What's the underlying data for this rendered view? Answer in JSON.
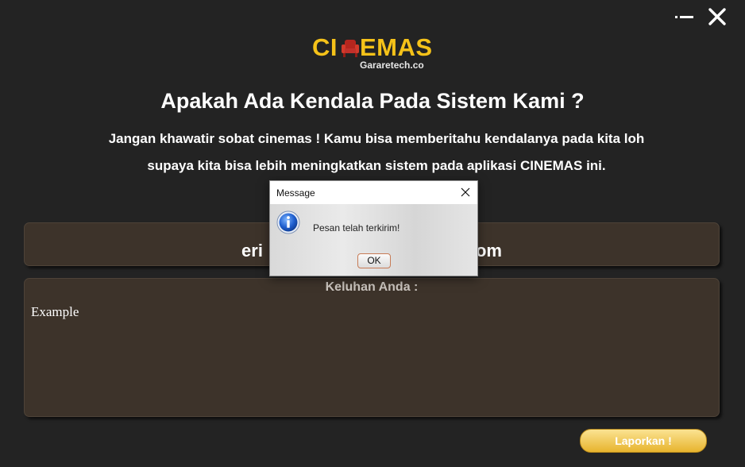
{
  "window_controls": {
    "minimize_icon": "minimize-icon",
    "close_icon": "close-icon"
  },
  "logo": {
    "text_left": "CI",
    "text_right": "EMAS",
    "seat_icon": "cinema-seat-icon",
    "subtitle": "Gararetech.co",
    "color": "#f5c219"
  },
  "header": {
    "title": "Apakah Ada Kendala Pada Sistem Kami ?",
    "description_line1": "Jangan khawatir sobat cinemas ! Kamu bisa memberitahu kendalanya pada kita loh",
    "description_line2": "supaya kita bisa lebih meningkatkan sistem pada aplikasi CINEMAS ini."
  },
  "email_field": {
    "value_visible_left": "eri",
    "value_visible_right": "om"
  },
  "complaint": {
    "label": "Keluhan Anda :",
    "value": "Example"
  },
  "report_button": {
    "label": "Laporkan !",
    "color": "#e7b42e"
  },
  "dialog": {
    "title": "Message",
    "message": "Pesan telah terkirim!",
    "ok_label": "OK",
    "icon": "info-icon"
  },
  "colors": {
    "background": "#232323",
    "panel": "#3d332a",
    "accent": "#f5c219"
  }
}
